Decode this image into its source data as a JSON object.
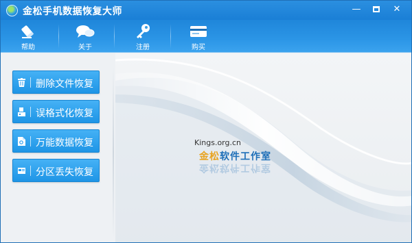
{
  "window": {
    "title": "金松手机数据恢复大师",
    "controls": {
      "minimize": "—",
      "close": "✕"
    }
  },
  "toolbar": {
    "items": [
      {
        "label": "帮助",
        "icon": "help-icon"
      },
      {
        "label": "关于",
        "icon": "about-chat-icon"
      },
      {
        "label": "注册",
        "icon": "key-icon"
      },
      {
        "label": "购买",
        "icon": "buy-card-icon"
      }
    ]
  },
  "sidebar": {
    "buttons": [
      {
        "label": "删除文件恢复",
        "icon": "trash-icon"
      },
      {
        "label": "误格式化恢复",
        "icon": "format-icon"
      },
      {
        "label": "万能数据恢复",
        "icon": "data-file-icon"
      },
      {
        "label": "分区丢失恢复",
        "icon": "partition-icon"
      }
    ]
  },
  "branding": {
    "url": "Kings.org.cn",
    "name_first": "金松",
    "name_rest": "软件工作室",
    "reflection": "金松软件工作室"
  },
  "colors": {
    "titlebar": "#1a7fd6",
    "toolbar": "#2b95e6",
    "button": "#2a9ef0",
    "brand_blue": "#1e6fb8",
    "brand_gold": "#e8a320"
  }
}
